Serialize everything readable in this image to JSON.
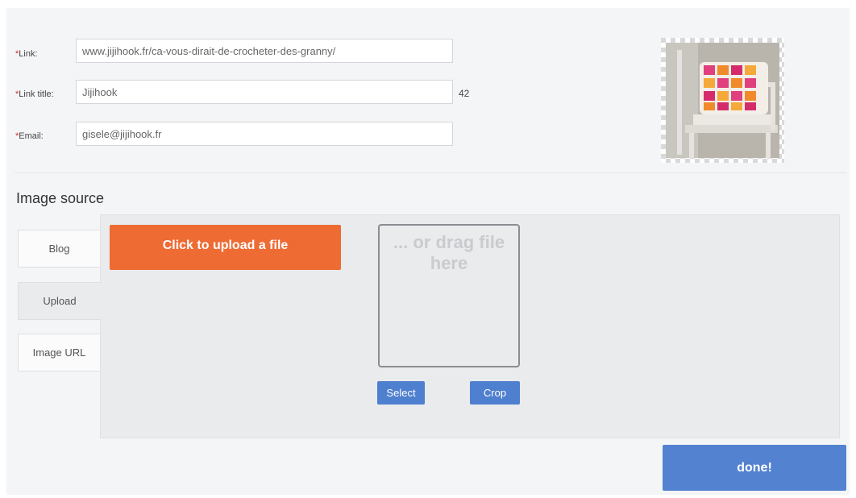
{
  "form": {
    "link": {
      "required_mark": "*",
      "label": "Link:",
      "value": "www.jijihook.fr/ca-vous-dirait-de-crocheter-des-granny/"
    },
    "link_title": {
      "required_mark": "*",
      "label": "Link title:",
      "value": "Jijihook",
      "char_count": "42"
    },
    "email": {
      "required_mark": "*",
      "label": "Email:",
      "value": "gisele@jijihook.fr"
    }
  },
  "preview": {
    "icon": "image-preview-crochet-pillow-on-chair"
  },
  "image_source": {
    "title": "Image source",
    "tabs": [
      {
        "label": "Blog",
        "active": false
      },
      {
        "label": "Upload",
        "active": true
      },
      {
        "label": "Image URL",
        "active": false
      }
    ],
    "upload_button": "Click to upload a file",
    "drop_text": "... or drag file here",
    "select_button": "Select",
    "crop_button": "Crop"
  },
  "done_button": "done!",
  "colors": {
    "accent_orange": "#ee6b34",
    "primary_blue": "#5382d0",
    "required_red": "#d62b2b"
  }
}
